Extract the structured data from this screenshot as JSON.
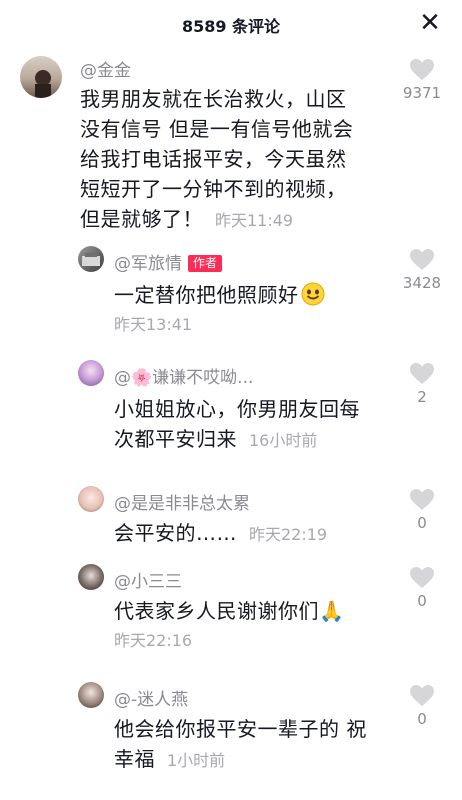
{
  "header": {
    "title": "8589 条评论",
    "close_label": "✕"
  },
  "comments": [
    {
      "user": "@金金",
      "text": "我男朋友就在长治救火，山区\n没有信号 但是一有信号他就会\n给我打电话报平安，今天虽然\n短短开了一分钟不到的视频，\n但是就够了！",
      "time": "昨天11:49",
      "likes": "9371"
    },
    {
      "user": "@军旅情",
      "badge": "作者",
      "text": "一定替你把他照顾好",
      "time": "昨天13:41",
      "likes": "3428"
    },
    {
      "user": "@🌸谦谦不哎呦...",
      "text": "小姐姐放心，你男朋友回每\n次都平安归来",
      "time": "16小时前",
      "likes": "2"
    },
    {
      "user": "@是是非非总太累",
      "text": "会平安的……",
      "time": "昨天22:19",
      "likes": "0"
    },
    {
      "user": "@小三三",
      "text": "代表家乡人民谢谢你们🙏",
      "time": "昨天22:16",
      "likes": "0"
    },
    {
      "user": "@-迷人燕",
      "text": "他会给你报平安一辈子的 祝\n幸福",
      "time": "1小时前",
      "likes": "0"
    }
  ]
}
